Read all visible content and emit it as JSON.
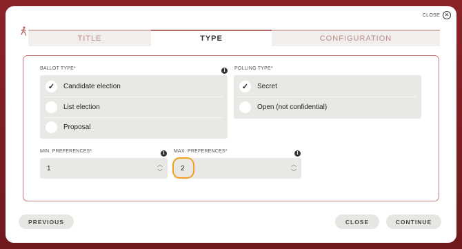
{
  "dialog": {
    "close_top_label": "CLOSE"
  },
  "tabs": [
    {
      "label": "TITLE",
      "active": false
    },
    {
      "label": "TYPE",
      "active": true
    },
    {
      "label": "CONFIGURATION",
      "active": false
    }
  ],
  "ballot_type": {
    "label": "BALLOT TYPE*",
    "options": [
      {
        "label": "Candidate election",
        "selected": true
      },
      {
        "label": "List election",
        "selected": false
      },
      {
        "label": "Proposal",
        "selected": false
      }
    ]
  },
  "polling_type": {
    "label": "POLLING TYPE*",
    "options": [
      {
        "label": "Secret",
        "selected": true
      },
      {
        "label": "Open (not confidential)",
        "selected": false
      }
    ]
  },
  "min_preferences": {
    "label": "MIN. PREFERENCES*",
    "value": "1"
  },
  "max_preferences": {
    "label": "MAX. PREFERENCES*",
    "value": "2"
  },
  "buttons": {
    "previous": "PREVIOUS",
    "close": "CLOSE",
    "continue": "CONTINUE"
  },
  "colors": {
    "frame": "#7a1f24",
    "accent": "#b46a66",
    "highlight": "#f0a21f",
    "field_bg": "#e9e8e4"
  }
}
